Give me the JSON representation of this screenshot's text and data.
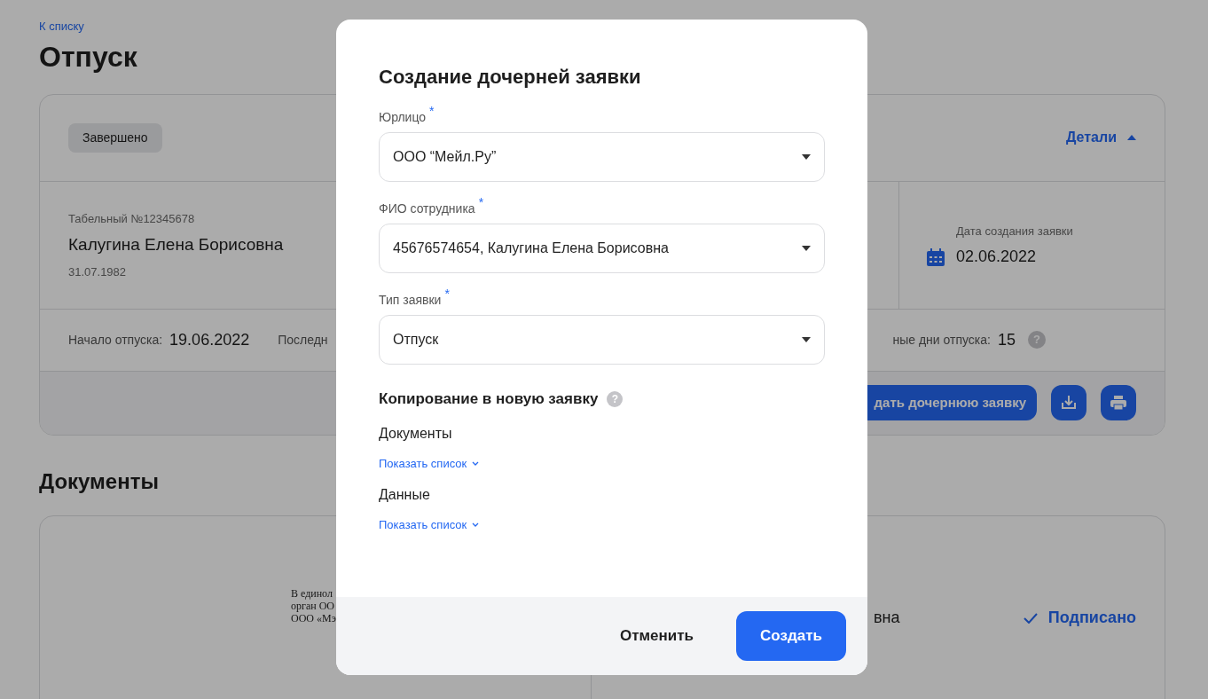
{
  "page": {
    "back_link": "К списку",
    "title": "Отпуск"
  },
  "request_card": {
    "status": "Завершено",
    "details_toggle": {
      "label": "Детали",
      "expanded": true
    },
    "employee": {
      "tab_number": "Табельный №12345678",
      "name": "Калугина Елена Борисовна",
      "birth_date": "31.07.1982"
    },
    "created": {
      "label": "Дата создания заявки",
      "value": "02.06.2022"
    },
    "start": {
      "label": "Начало отпуска:",
      "value": "19.06.2022"
    },
    "last_label": "Последн",
    "remaining": {
      "label": "ные дни отпуска:",
      "value": "15",
      "help": "?"
    },
    "create_child_button": "дать дочернюю заявку"
  },
  "documents": {
    "title": "Документы",
    "preview_lines": [
      "В единол",
      "орган ОО",
      "ООО «Мэ"
    ],
    "signer": "вна",
    "status": "Подписано"
  },
  "dialog": {
    "title": "Создание дочерней заявки",
    "fields": [
      {
        "label": "Юрлицо",
        "required_mark": "*",
        "value": "ООО “Мейл.Ру”"
      },
      {
        "label": "ФИО сотрудника",
        "required_mark": "*",
        "value": "45676574654, Калугина Елена Борисовна"
      },
      {
        "label": "Тип заявки",
        "required_mark": "*",
        "value": "Отпуск"
      }
    ],
    "copy_section": {
      "title": "Копирование в новую заявку",
      "help": "?",
      "groups": [
        {
          "title": "Документы",
          "toggle": "Показать список",
          "expanded": false
        },
        {
          "title": "Данные",
          "toggle": "Показать список",
          "expanded": false
        }
      ]
    },
    "buttons": {
      "cancel": "Отменить",
      "submit": "Создать"
    }
  }
}
